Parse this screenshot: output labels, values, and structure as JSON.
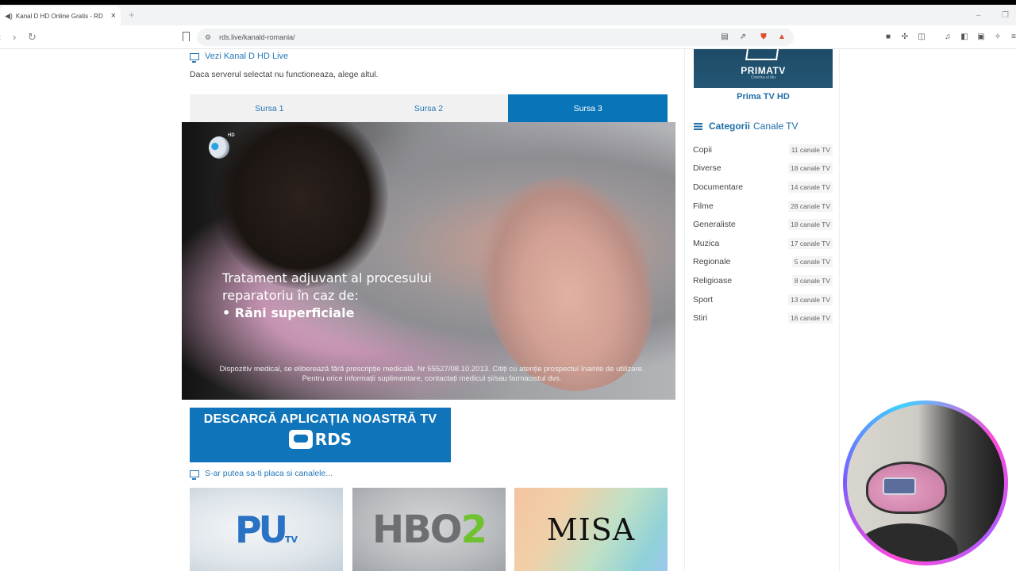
{
  "browser": {
    "tab_title": "Kanal D HD Online Gratis - RD",
    "url": "rds.live/kanald-romania/"
  },
  "page": {
    "live_link": "Vezi Kanal D HD Live",
    "server_notice": "Daca serverul selectat nu functioneaza, alege altul.",
    "sources": [
      "Sursa 1",
      "Sursa 2",
      "Sursa 3"
    ],
    "active_source": "Sursa 3",
    "video": {
      "channel_logo_badge": "HD",
      "overlay_line1": "Tratament adjuvant al procesului",
      "overlay_line2": "reparatoriu în caz de:",
      "overlay_line3": "• Răni superficiale",
      "disclaimer": "Dispozitiv medical, se eliberează fără prescripție medicală. Nr 55527/08.10.2013. Citiți cu atenție prospectul înainte de utilizare. Pentru orice informații suplimentare, contactați medicul și/sau farmacistul dvs."
    },
    "app_banner": {
      "line1": "DESCARCĂ APLICAȚIA NOASTRĂ TV",
      "brand": "RDS"
    },
    "suggestions_link": "S-ar putea sa-ti placa si canalele...",
    "thumbnails": [
      {
        "logo_main": "PU",
        "logo_sub": "TV"
      },
      {
        "logo_main": "HBO",
        "logo_num": "2"
      },
      {
        "logo_main": "MISA"
      }
    ]
  },
  "sidebar": {
    "featured": {
      "logo_text": "PRIMATV",
      "logo_tagline": "Cinema-ul tău",
      "name": "Prima TV HD"
    },
    "categories_heading_bold": "Categorii",
    "categories_heading_rest": "Canale TV",
    "categories": [
      {
        "name": "Copii",
        "count": "11 canale TV"
      },
      {
        "name": "Diverse",
        "count": "18 canale TV"
      },
      {
        "name": "Documentare",
        "count": "14 canale TV"
      },
      {
        "name": "Filme",
        "count": "28 canale TV"
      },
      {
        "name": "Generaliste",
        "count": "18 canale TV"
      },
      {
        "name": "Muzica",
        "count": "17 canale TV"
      },
      {
        "name": "Regionale",
        "count": "5 canale TV"
      },
      {
        "name": "Religioase",
        "count": "8 canale TV"
      },
      {
        "name": "Sport",
        "count": "13 canale TV"
      },
      {
        "name": "Stiri",
        "count": "16 canale TV"
      }
    ]
  },
  "colors": {
    "accent": "#0a74b9",
    "link": "#2577b7"
  }
}
